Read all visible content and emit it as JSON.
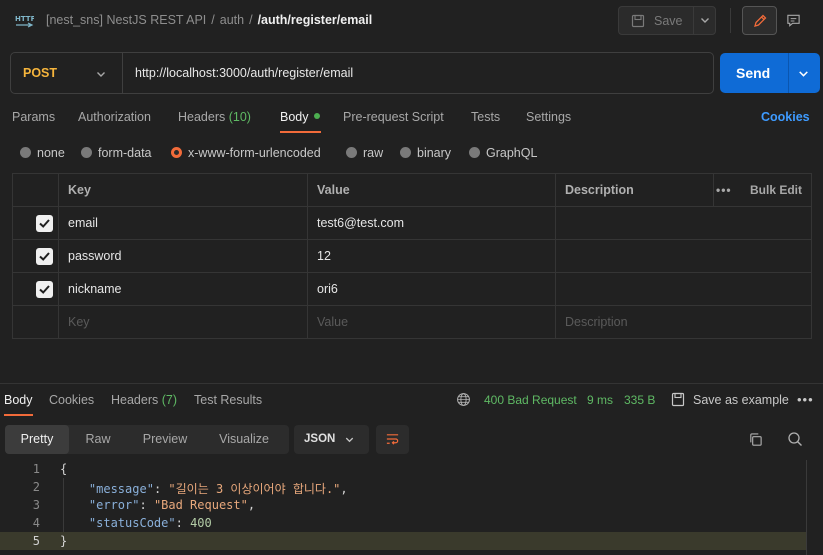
{
  "header": {
    "breadcrumb": [
      "[nest_sns] NestJS REST API",
      "auth",
      "/auth/register/email"
    ],
    "save_label": "Save"
  },
  "request": {
    "method": "POST",
    "url": "http://localhost:3000/auth/register/email",
    "send_label": "Send"
  },
  "request_tabs": {
    "params": "Params",
    "authorization": "Authorization",
    "headers": "Headers",
    "headers_count": "(10)",
    "body": "Body",
    "pre_request": "Pre-request Script",
    "tests": "Tests",
    "settings": "Settings",
    "cookies": "Cookies"
  },
  "body_types": {
    "none": "none",
    "form_data": "form-data",
    "urlencoded": "x-www-form-urlencoded",
    "raw": "raw",
    "binary": "binary",
    "graphql": "GraphQL",
    "selected": "x-www-form-urlencoded"
  },
  "params_table": {
    "headers": {
      "key": "Key",
      "value": "Value",
      "description": "Description",
      "bulk_edit": "Bulk Edit",
      "more": "•••"
    },
    "rows": [
      {
        "checked": true,
        "key": "email",
        "value": "test6@test.com",
        "description": ""
      },
      {
        "checked": true,
        "key": "password",
        "value": "12",
        "description": ""
      },
      {
        "checked": true,
        "key": "nickname",
        "value": "ori6",
        "description": ""
      }
    ],
    "placeholder": {
      "key": "Key",
      "value": "Value",
      "description": "Description"
    }
  },
  "response_tabs": {
    "body": "Body",
    "cookies": "Cookies",
    "headers": "Headers",
    "headers_count": "(7)",
    "test_results": "Test Results"
  },
  "response_meta": {
    "status": "400 Bad Request",
    "time": "9 ms",
    "size": "335 B",
    "save_example": "Save as example",
    "more": "•••"
  },
  "view_modes": {
    "pretty": "Pretty",
    "raw": "Raw",
    "preview": "Preview",
    "visualize": "Visualize",
    "format": "JSON"
  },
  "response_body": {
    "line_numbers": [
      "1",
      "2",
      "3",
      "4",
      "5"
    ],
    "open_brace": "{",
    "close_brace": "}",
    "message_key": "\"message\"",
    "message_value": "\"길이는 3 이상이어야 합니다.\"",
    "error_key": "\"error\"",
    "error_value": "\"Bad Request\"",
    "status_key": "\"statusCode\"",
    "status_value": "400"
  },
  "colors": {
    "accent": "#f26b3a",
    "send": "#0f6bd6",
    "method": "#f6b53c",
    "status_ok_text": "#5fb964",
    "link": "#3e9bff"
  }
}
